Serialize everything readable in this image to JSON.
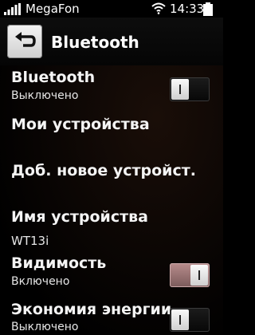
{
  "status_bar": {
    "carrier": "MegaFon",
    "time": "14:33",
    "icons": [
      "signal-icon",
      "wifi-icon",
      "battery-icon"
    ]
  },
  "header": {
    "title": "Bluetooth",
    "back_icon": "back-arrow-icon"
  },
  "settings": {
    "bluetooth": {
      "title": "Bluetooth",
      "status": "Выключено",
      "enabled": false
    },
    "my_devices": {
      "title": "Мои устройства"
    },
    "add_device": {
      "title": "Доб. новое устройст."
    },
    "device_name": {
      "title": "Имя устройства",
      "value": "WT13i"
    },
    "visibility": {
      "title": "Видимость",
      "status": "Включено",
      "enabled": true
    },
    "power_saving": {
      "title": "Экономия энергии",
      "status": "Выключено",
      "enabled": false
    }
  },
  "colors": {
    "background": "#000000",
    "text": "#ffffff",
    "toggle_on": "#a07878"
  }
}
